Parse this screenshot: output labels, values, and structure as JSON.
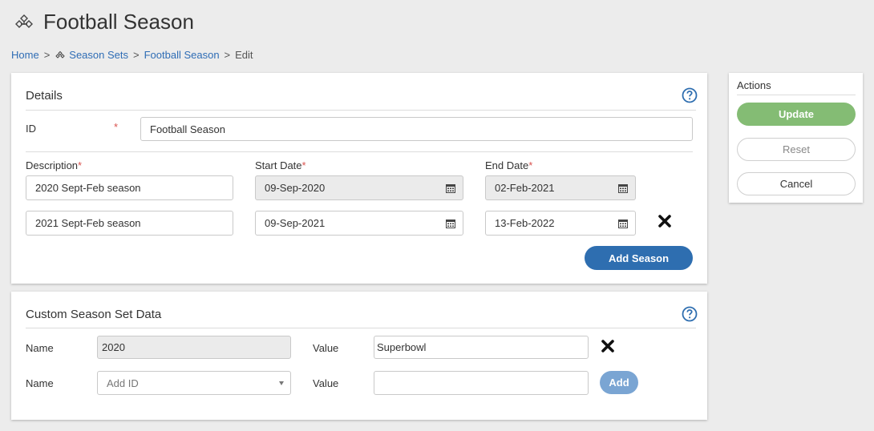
{
  "header": {
    "title": "Football Season",
    "icon": "season-set-icon"
  },
  "breadcrumb": {
    "home": "Home",
    "sep": ">",
    "season_sets": "Season Sets",
    "football_season": "Football Season",
    "current": "Edit"
  },
  "details": {
    "title": "Details",
    "id_label": "ID",
    "required_mark": "*",
    "id_value": "Football Season",
    "description_label": "Description",
    "start_label": "Start Date",
    "end_label": "End Date",
    "rows": [
      {
        "description": "2020 Sept-Feb season",
        "start": "09-Sep-2020",
        "end": "02-Feb-2021",
        "readonly_dates": true,
        "removable": false
      },
      {
        "description": "2021 Sept-Feb season",
        "start": "09-Sep-2021",
        "end": "13-Feb-2022",
        "readonly_dates": false,
        "removable": true
      }
    ],
    "add_button": "Add Season"
  },
  "custom_data": {
    "title": "Custom Season Set Data",
    "name_label": "Name",
    "value_label": "Value",
    "rows": [
      {
        "name": "2020",
        "value": "Superbowl"
      },
      {
        "name_placeholder": "Add ID",
        "value": ""
      }
    ],
    "add_button": "Add"
  },
  "actions": {
    "title": "Actions",
    "update": "Update",
    "reset": "Reset",
    "cancel": "Cancel"
  },
  "colors": {
    "link": "#2f6db5",
    "primary": "#2e6eb0",
    "update": "#84bc74",
    "required": "#d9534f"
  }
}
